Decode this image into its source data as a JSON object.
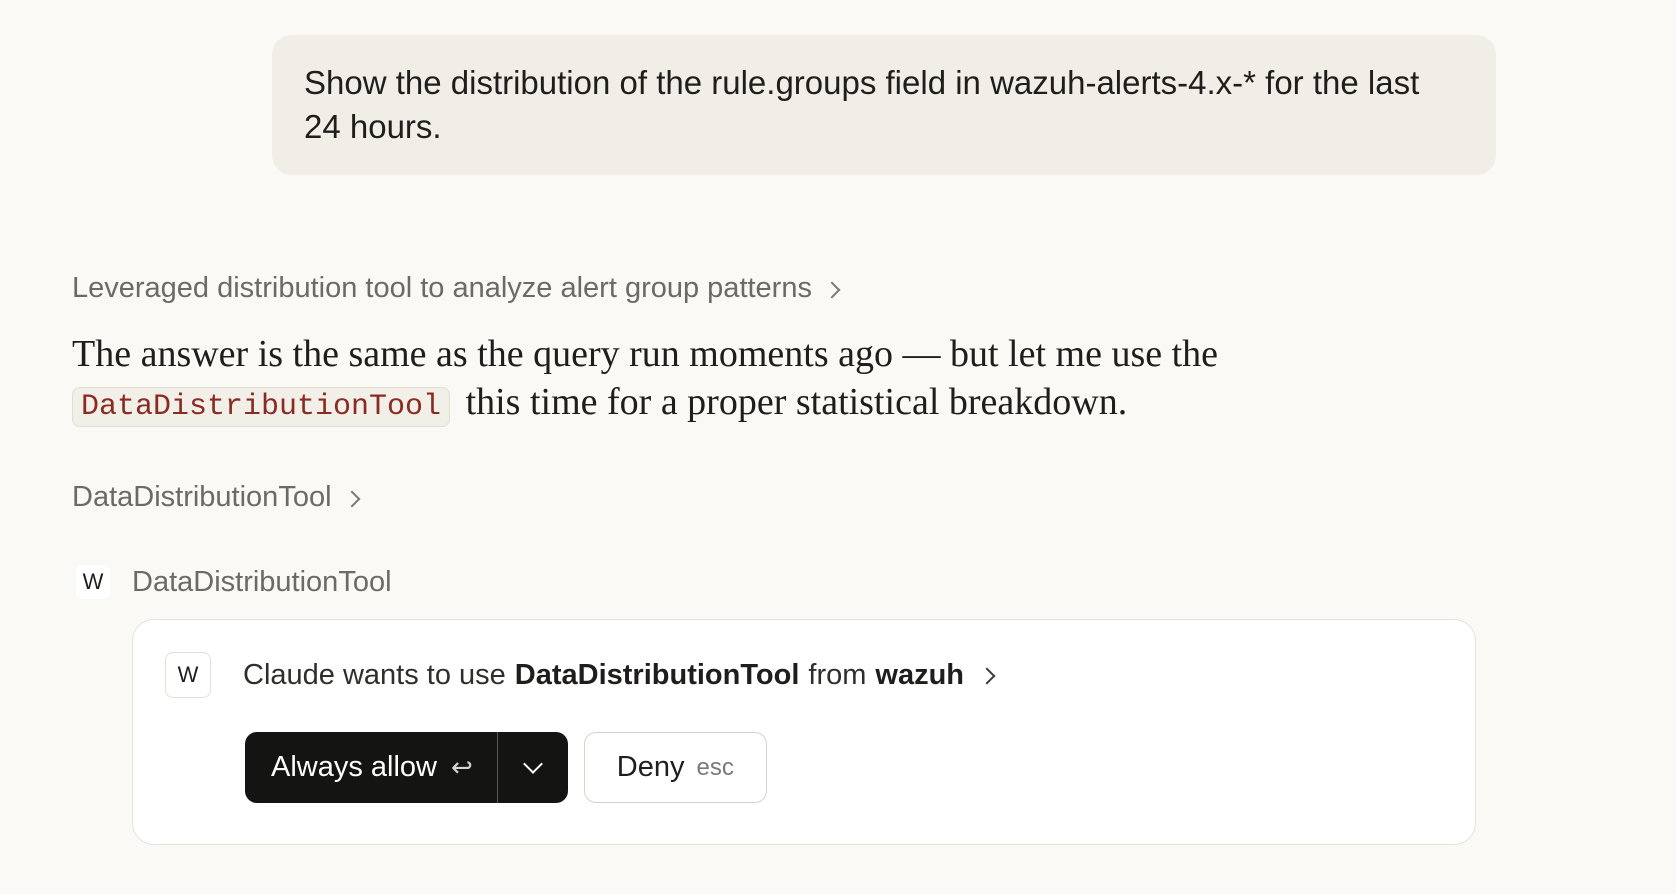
{
  "user_message": {
    "text": "Show the distribution of the rule.groups field in wazuh-alerts-4.x-* for the last 24 hours."
  },
  "thinking": {
    "label": "Leveraged distribution tool to analyze alert group patterns"
  },
  "answer": {
    "text_before": "The answer is the same as the query run moments ago — but let me use the",
    "code": "DataDistributionTool",
    "text_after": "this time for a proper statistical breakdown."
  },
  "tool_call": {
    "label": "DataDistributionTool"
  },
  "tool_header": {
    "badge": "W",
    "label": "DataDistributionTool"
  },
  "permission": {
    "badge": "W",
    "prefix": "Claude wants to use",
    "tool": "DataDistributionTool",
    "middle": "from",
    "server": "wazuh",
    "allow_label": "Always allow",
    "allow_hint": "↩",
    "deny_label": "Deny",
    "deny_hint": "esc"
  },
  "colors": {
    "background": "#faf9f5",
    "user_bubble": "#f0eee6",
    "primary_button": "#141413",
    "code_text": "#8a2b22"
  },
  "icons": {
    "expand": "chevron-right-icon",
    "dropdown": "chevron-down-icon",
    "enter": "enter-key-icon"
  }
}
